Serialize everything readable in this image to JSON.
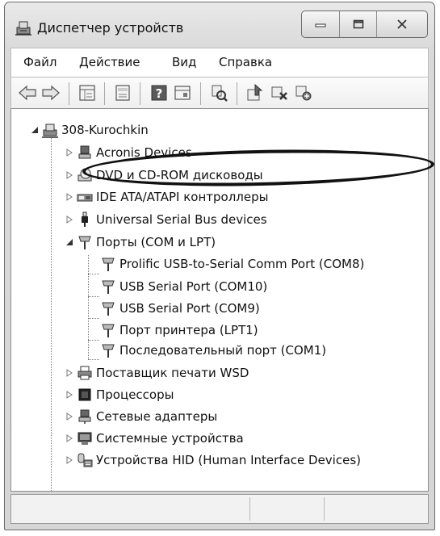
{
  "window": {
    "title": "Диспетчер устройств"
  },
  "menu": [
    "Файл",
    "Действие",
    "Вид",
    "Справка"
  ],
  "toolbar": {
    "icons": [
      "back-arrow-icon",
      "forward-arrow-icon",
      "properties-icon",
      "list-view-icon",
      "help-icon",
      "driver-icon",
      "scan-hardware-icon",
      "update-driver-icon",
      "disable-device-icon",
      "uninstall-device-icon"
    ]
  },
  "tree": {
    "root": "308-Kurochkin",
    "categories": [
      {
        "label": "Acronis Devices",
        "expanded": false
      },
      {
        "label": "DVD и CD-ROM дисководы",
        "expanded": false
      },
      {
        "label": "IDE ATA/ATAPI контроллеры",
        "expanded": false
      },
      {
        "label": "Universal Serial Bus devices",
        "expanded": false
      },
      {
        "label": "Порты (COM и LPT)",
        "expanded": true
      },
      {
        "label": "Поставщик печати WSD",
        "expanded": false
      },
      {
        "label": "Процессоры",
        "expanded": false
      },
      {
        "label": "Сетевые адаптеры",
        "expanded": false
      },
      {
        "label": "Системные устройства",
        "expanded": false
      },
      {
        "label": "Устройства HID (Human Interface Devices)",
        "expanded": false
      }
    ],
    "ports": [
      "Prolific USB-to-Serial Comm Port (COM8)",
      "USB Serial Port (COM10)",
      "USB Serial Port (COM9)",
      "Порт принтера (LPT1)",
      "Последовательный порт (COM1)"
    ]
  }
}
